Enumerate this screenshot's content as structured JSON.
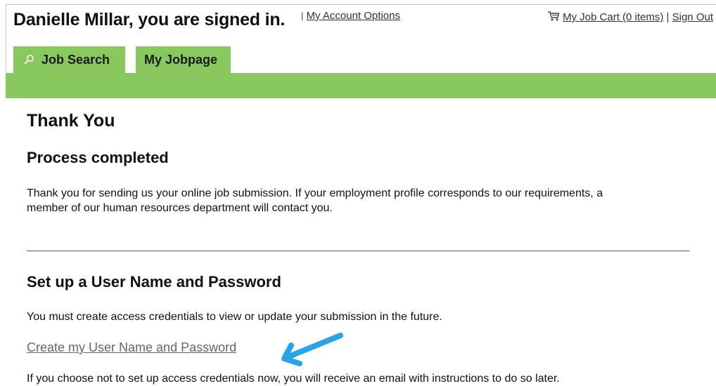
{
  "header": {
    "welcome": "Danielle Millar, you are signed in.",
    "separator": "|",
    "account_options": "My Account Options",
    "cart_icon": "cart-icon",
    "job_cart": "My Job Cart (0 items)",
    "right_separator": "|",
    "sign_out": "Sign Out"
  },
  "tabs": [
    {
      "label": "Job Search",
      "icon": "search-icon"
    },
    {
      "label": "My Jobpage"
    }
  ],
  "colors": {
    "tab_green": "#88c85e",
    "arrow_blue": "#29a3ea",
    "link_gray": "#666666"
  },
  "main": {
    "title": "Thank You",
    "subtitle": "Process completed",
    "thanks_text": "Thank you for sending us your online job submission. If your employment profile corresponds to our requirements, a member of our human resources department will contact you.",
    "setup_heading": "Set up a User Name and Password",
    "must_text": "You must create access credentials to view or update your submission in the future.",
    "create_link": "Create my User Name and Password",
    "later_text": "If you choose not to set up access credentials now, you will receive an email with instructions to do so later."
  }
}
